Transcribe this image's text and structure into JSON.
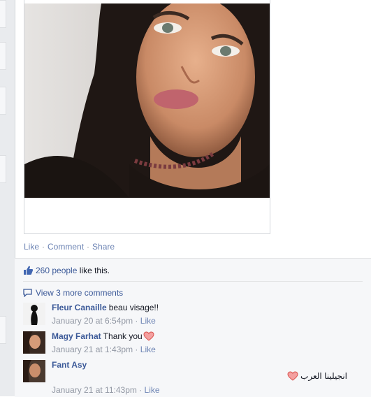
{
  "post": {
    "actions": {
      "like": "Like",
      "comment": "Comment",
      "share": "Share",
      "separator": "·"
    }
  },
  "ufi": {
    "likes": {
      "count_text": "260 people",
      "suffix": "like this."
    },
    "view_more": "View 3 more comments",
    "comments": [
      {
        "author": "Fleur Canaille",
        "text": "beau visage!!",
        "timestamp": "January 20 at 6:54pm",
        "like": "Like"
      },
      {
        "author": "Magy Farhat",
        "text": "Thank you",
        "timestamp": "January 21 at 1:43pm",
        "like": "Like"
      },
      {
        "author": "Fant Asy",
        "text": "انجيلينا العرب",
        "timestamp": "January 21 at 11:43pm",
        "like": "Like"
      }
    ],
    "meta_separator": "·"
  },
  "colors": {
    "link": "#3b5998",
    "muted_link": "#6d84b4",
    "meta": "#9197a3",
    "panel": "#f6f7f9"
  },
  "icons": [
    "thumbs-up-icon",
    "comment-bubble-icon",
    "heart-icon"
  ]
}
